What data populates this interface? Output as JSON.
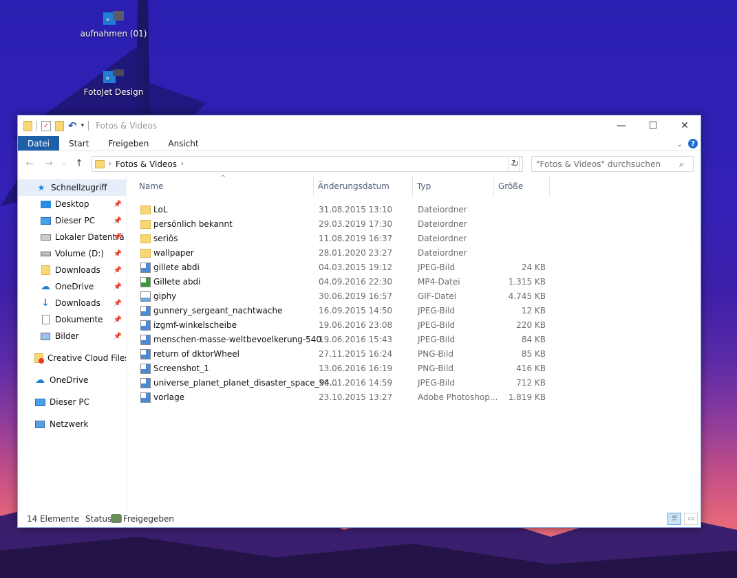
{
  "desktop": {
    "icons": [
      {
        "label": "aufnahmen (01)"
      },
      {
        "label": "FotoJet Design"
      }
    ]
  },
  "window": {
    "title": "Fotos & Videos",
    "controls": {
      "minimize": "—",
      "maximize": "☐",
      "close": "✕"
    },
    "ribbon": {
      "tabs": [
        "Datei",
        "Start",
        "Freigeben",
        "Ansicht"
      ],
      "help": "?"
    },
    "address": {
      "crumb": "Fotos & Videos",
      "search_placeholder": "\"Fotos & Videos\" durchsuchen"
    },
    "nav": {
      "items": [
        {
          "label": "Schnellzugriff"
        },
        {
          "label": "Desktop"
        },
        {
          "label": "Dieser PC"
        },
        {
          "label": "Lokaler Datenträ"
        },
        {
          "label": "Volume (D:)"
        },
        {
          "label": "Downloads"
        },
        {
          "label": "OneDrive"
        },
        {
          "label": "Downloads"
        },
        {
          "label": "Dokumente"
        },
        {
          "label": "Bilder"
        },
        {
          "label": "Creative Cloud Files"
        },
        {
          "label": "OneDrive"
        },
        {
          "label": "Dieser PC"
        },
        {
          "label": "Netzwerk"
        }
      ]
    },
    "columns": {
      "name": "Name",
      "date": "Änderungsdatum",
      "type": "Typ",
      "size": "Größe"
    },
    "files": [
      {
        "name": "LoL",
        "date": "31.08.2015 13:10",
        "type": "Dateiordner",
        "size": ""
      },
      {
        "name": "persönlich bekannt",
        "date": "29.03.2019 17:30",
        "type": "Dateiordner",
        "size": ""
      },
      {
        "name": "seriös",
        "date": "11.08.2019 16:37",
        "type": "Dateiordner",
        "size": ""
      },
      {
        "name": "wallpaper",
        "date": "28.01.2020 23:27",
        "type": "Dateiordner",
        "size": ""
      },
      {
        "name": "gillete abdi",
        "date": "04.03.2015 19:12",
        "type": "JPEG-Bild",
        "size": "24 KB"
      },
      {
        "name": "Gillete abdi",
        "date": "04.09.2016 22:30",
        "type": "MP4-Datei",
        "size": "1.315 KB"
      },
      {
        "name": "giphy",
        "date": "30.06.2019 16:57",
        "type": "GIF-Datei",
        "size": "4.745 KB"
      },
      {
        "name": "gunnery_sergeant_nachtwache",
        "date": "16.09.2015 14:50",
        "type": "JPEG-Bild",
        "size": "12 KB"
      },
      {
        "name": "izgmf-winkelscheibe",
        "date": "19.06.2016 23:08",
        "type": "JPEG-Bild",
        "size": "220 KB"
      },
      {
        "name": "menschen-masse-weltbevoelkerung-540...",
        "date": "19.06.2016 15:43",
        "type": "JPEG-Bild",
        "size": "84 KB"
      },
      {
        "name": "return of dktorWheel",
        "date": "27.11.2015 16:24",
        "type": "PNG-Bild",
        "size": "85 KB"
      },
      {
        "name": "Screenshot_1",
        "date": "13.06.2016 16:19",
        "type": "PNG-Bild",
        "size": "416 KB"
      },
      {
        "name": "universe_planet_planet_disaster_space_94...",
        "date": "16.01.2016 14:59",
        "type": "JPEG-Bild",
        "size": "712 KB"
      },
      {
        "name": "vorlage",
        "date": "23.10.2015 13:27",
        "type": "Adobe Photoshop...",
        "size": "1.819 KB"
      }
    ],
    "status": {
      "count": "14 Elemente",
      "status_label": "Status:",
      "status_value": "Freigegeben"
    }
  }
}
